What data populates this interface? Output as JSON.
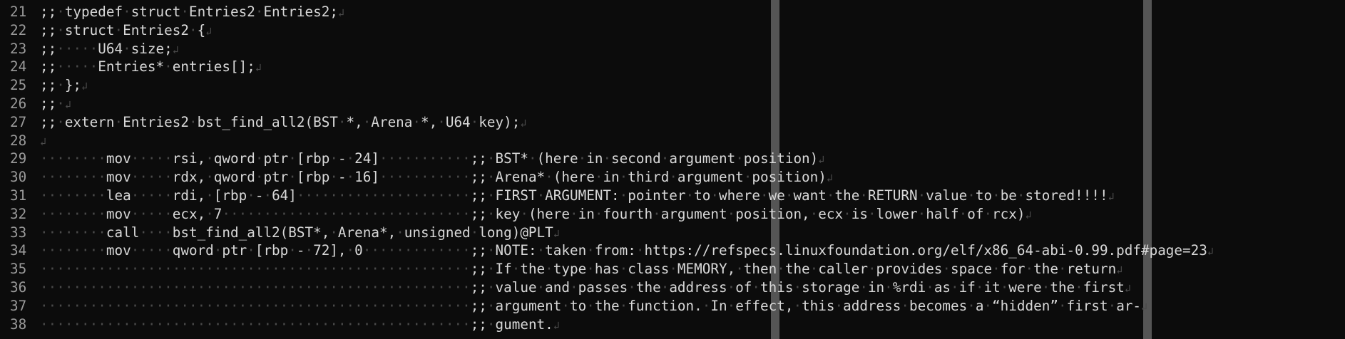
{
  "editor": {
    "symbols": {
      "space": "·",
      "eol": "↲"
    },
    "lines": [
      {
        "number": "21",
        "indent": 0,
        "code": ";; typedef struct Entries2 Entries2;"
      },
      {
        "number": "22",
        "indent": 0,
        "code": ";; struct Entries2 {"
      },
      {
        "number": "23",
        "indent": 0,
        "code": ";;     U64 size;"
      },
      {
        "number": "24",
        "indent": 0,
        "code": ";;     Entries* entries[];"
      },
      {
        "number": "25",
        "indent": 0,
        "code": ";; };"
      },
      {
        "number": "26",
        "indent": 0,
        "code": ";; "
      },
      {
        "number": "27",
        "indent": 0,
        "code": ";; extern Entries2 bst_find_all2(BST *, Arena *, U64 key);"
      },
      {
        "number": "28",
        "indent": 0,
        "code": ""
      },
      {
        "number": "29",
        "indent": 8,
        "code": "mov     rsi, qword ptr [rbp - 24]           ;; BST* (here in second argument position)"
      },
      {
        "number": "30",
        "indent": 8,
        "code": "mov     rdx, qword ptr [rbp - 16]           ;; Arena* (here in third argument position)"
      },
      {
        "number": "31",
        "indent": 8,
        "code": "lea     rdi, [rbp - 64]                     ;; FIRST ARGUMENT: pointer to where we want the RETURN value to be stored!!!!"
      },
      {
        "number": "32",
        "indent": 8,
        "code": "mov     ecx, 7                              ;; key (here in fourth argument position, ecx is lower half of rcx)"
      },
      {
        "number": "33",
        "indent": 8,
        "code": "call    bst_find_all2(BST*, Arena*, unsigned long)@PLT"
      },
      {
        "number": "34",
        "indent": 8,
        "code": "mov     qword ptr [rbp - 72], 0             ;; NOTE: taken from: https://refspecs.linuxfoundation.org/elf/x86_64-abi-0.99.pdf#page=23"
      },
      {
        "number": "35",
        "indent": 52,
        "code": ";; If the type has class MEMORY, then the caller provides space for the return"
      },
      {
        "number": "36",
        "indent": 52,
        "code": ";; value and passes the address of this storage in %rdi as if it were the first"
      },
      {
        "number": "37",
        "indent": 52,
        "code": ";; argument to the function. In effect, this address becomes a “hidden” first ar-"
      },
      {
        "number": "38",
        "indent": 52,
        "code": ";; gument."
      }
    ]
  }
}
